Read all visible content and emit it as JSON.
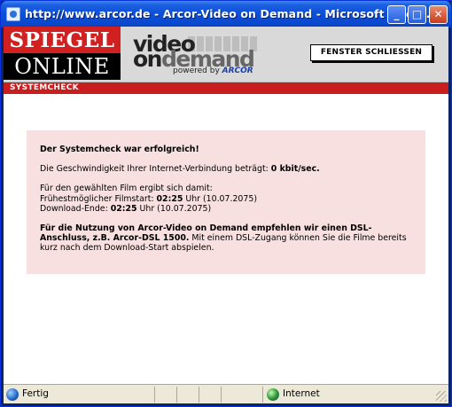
{
  "window": {
    "title": "http://www.arcor.de - Arcor-Video on Demand - Microsoft Inter...",
    "buttons": {
      "minimize": "_",
      "maximize": "□",
      "close": "✕"
    }
  },
  "header": {
    "logo_top": "SPIEGEL",
    "logo_bottom": "ONLINE",
    "vod_word1": "video",
    "vod_on": "on",
    "vod_demand": "demand",
    "powered_by": "powered by",
    "powered_brand": "ARCOR",
    "close_button": "FENSTER SCHLIESSEN"
  },
  "section_bar": "SYSTEMCHECK",
  "message": {
    "headline": "Der Systemcheck war erfolgreich!",
    "speed_prefix": "Die Geschwindigkeit Ihrer Internet-Verbindung beträgt: ",
    "speed_value": "0 kbit/sec.",
    "film_intro": "Für den gewählten Film ergibt sich damit:",
    "start_label": "Frühestmöglicher Filmstart: ",
    "start_time": "02:25",
    "start_suffix": " Uhr (10.07.2075)",
    "end_label": "Download-Ende: ",
    "end_time": "02:25",
    "end_suffix": " Uhr (10.07.2075)",
    "recommend_bold": "Für die Nutzung von Arcor-Video on Demand empfehlen wir einen DSL-Anschluss, z.B. Arcor-DSL 1500.",
    "recommend_rest": " Mit einem DSL-Zugang können Sie die Filme bereits kurz nach dem Download-Start abspielen."
  },
  "statusbar": {
    "ready": "Fertig",
    "zone": "Internet"
  },
  "colors": {
    "titlebar": "#0b4fd8",
    "spiegel_red": "#d21f1f",
    "section_red": "#c81e1e",
    "message_bg": "#f8e0e0"
  }
}
